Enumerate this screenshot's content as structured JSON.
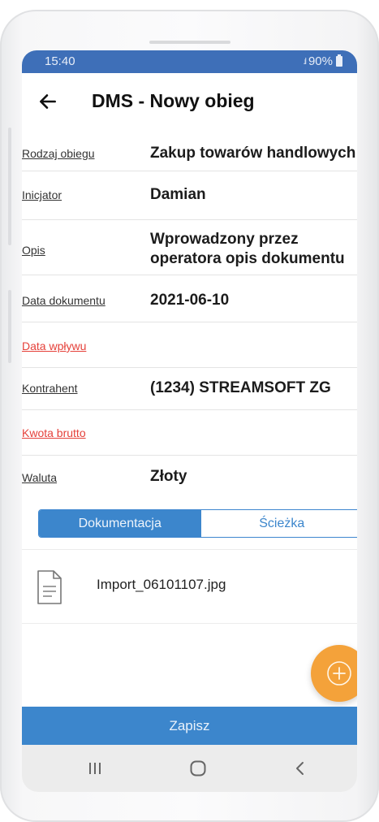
{
  "status_bar": {
    "time": "15:40",
    "signal_icon": "signal-icon",
    "battery": "90%",
    "battery_icon": "battery-icon"
  },
  "app_bar": {
    "back_icon": "arrow-left-icon",
    "title": "DMS - Nowy obieg"
  },
  "form": {
    "fields": [
      {
        "label": "Rodzaj obiegu",
        "value": "Zakup towarów handlowych",
        "required": false
      },
      {
        "label": "Inicjator",
        "value": "Damian",
        "required": false
      },
      {
        "label": "Opis",
        "value": "Wprowadzony przez operatora opis dokumentu",
        "required": false
      },
      {
        "label": "Data dokumentu",
        "value": "2021-06-10",
        "required": false
      },
      {
        "label": "Data wpływu",
        "value": "",
        "required": true
      },
      {
        "label": "Kontrahent",
        "value": "(1234) STREAMSOFT ZG",
        "required": false
      },
      {
        "label": "Kwota brutto",
        "value": "",
        "required": true
      },
      {
        "label": "Waluta",
        "value": "Złoty",
        "required": false
      }
    ]
  },
  "tabs": {
    "items": [
      {
        "label": "Dokumentacja",
        "active": true
      },
      {
        "label": "Ścieżka",
        "active": false
      }
    ]
  },
  "attachments": [
    {
      "icon": "document-icon",
      "name": "Import_06101107.jpg"
    }
  ],
  "fab": {
    "icon": "plus-circle-icon"
  },
  "save_button": {
    "label": "Zapisz"
  },
  "nav_bar": {
    "items": [
      "recent-apps-icon",
      "home-icon",
      "back-icon"
    ]
  },
  "colors": {
    "primary": "#3c86cc",
    "status_bar": "#3e6fb8",
    "accent": "#f4a23a",
    "required_label": "#e5413a"
  }
}
